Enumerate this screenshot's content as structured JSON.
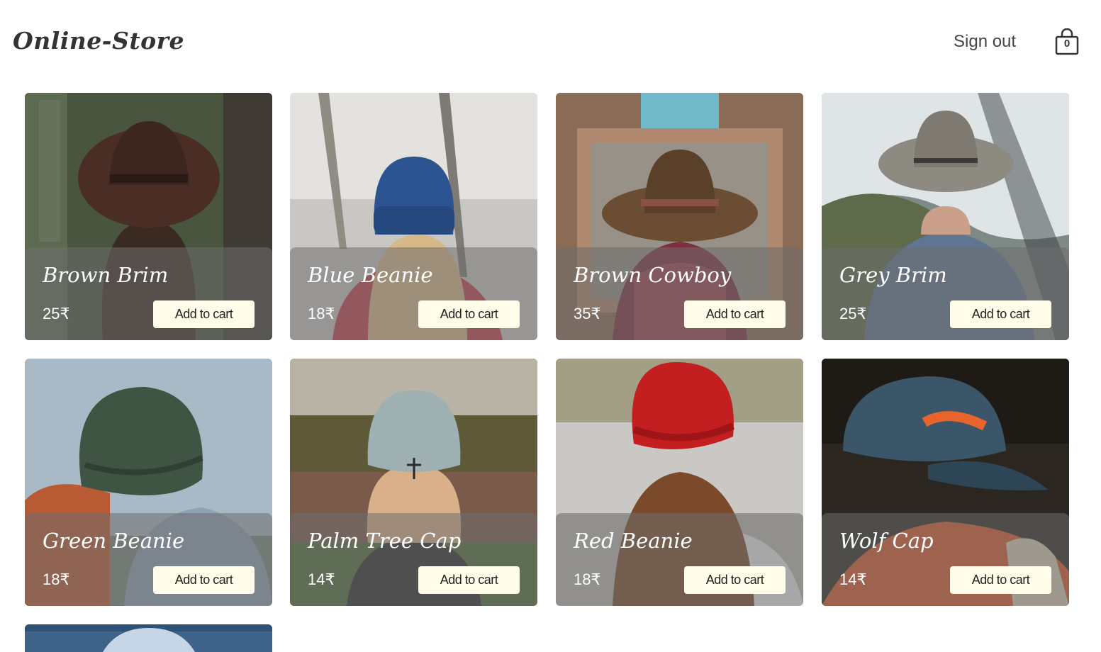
{
  "header": {
    "logo": "Online-Store",
    "signout_label": "Sign out",
    "cart_count": "0",
    "cart_icon": "shopping-bag-icon"
  },
  "products": [
    {
      "name": "Brown Brim",
      "price": "25₹",
      "button": "Add to cart"
    },
    {
      "name": "Blue Beanie",
      "price": "18₹",
      "button": "Add to cart"
    },
    {
      "name": "Brown Cowboy",
      "price": "35₹",
      "button": "Add to cart"
    },
    {
      "name": "Grey Brim",
      "price": "25₹",
      "button": "Add to cart"
    },
    {
      "name": "Green Beanie",
      "price": "18₹",
      "button": "Add to cart"
    },
    {
      "name": "Palm Tree Cap",
      "price": "14₹",
      "button": "Add to cart"
    },
    {
      "name": "Red Beanie",
      "price": "18₹",
      "button": "Add to cart"
    },
    {
      "name": "Wolf Cap",
      "price": "14₹",
      "button": "Add to cart"
    }
  ],
  "colors": {
    "button_bg": "#fffde9",
    "overlay": "rgba(110,110,110,0.55)"
  }
}
